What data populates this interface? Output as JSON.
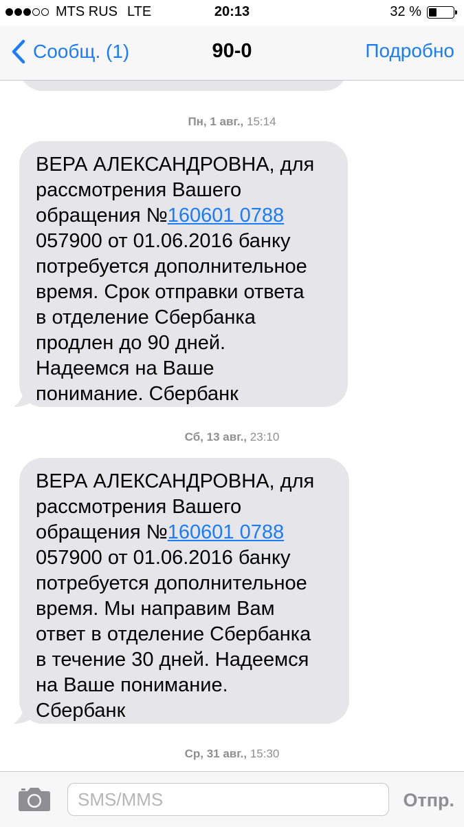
{
  "status_bar": {
    "signal_filled": 3,
    "signal_empty": 2,
    "carrier": "MTS RUS",
    "network": "LTE",
    "time": "20:13",
    "battery_text": "32 %",
    "battery_level": 0.32
  },
  "nav": {
    "back_label": "Сообщ. (1)",
    "title": "90-0",
    "details_label": "Подробно"
  },
  "messages": [
    {
      "day": "Пн, 1 авг.,",
      "time": "15:14",
      "lines": [
        [
          "ВЕРА АЛЕКСАНДРОВНА, для"
        ],
        [
          "рассмотрения Вашего"
        ],
        [
          "обращения №",
          "160601 0788"
        ],
        [
          "057900 от 01.06.2016 банку"
        ],
        [
          "потребуется дополнительное"
        ],
        [
          "время. Срок отправки ответа"
        ],
        [
          "в отделение Сбербанка"
        ],
        [
          "продлен до 90 дней."
        ],
        [
          "Надеемся на Ваше"
        ],
        [
          "понимание. Сбербанк"
        ]
      ]
    },
    {
      "day": "Сб, 13 авг.,",
      "time": "23:10",
      "lines": [
        [
          "ВЕРА АЛЕКСАНДРОВНА, для"
        ],
        [
          "рассмотрения Вашего"
        ],
        [
          "обращения №",
          "160601 0788"
        ],
        [
          "057900 от 01.06.2016 банку"
        ],
        [
          "потребуется дополнительное"
        ],
        [
          "время. Мы направим Вам"
        ],
        [
          "ответ в отделение Сбербанка"
        ],
        [
          "в течение 30 дней. Надеемся"
        ],
        [
          "на Ваше понимание."
        ],
        [
          "Сбербанк"
        ]
      ]
    },
    {
      "day": "Ср, 31 авг.,",
      "time": "15:30",
      "lines": []
    }
  ],
  "input": {
    "placeholder": "SMS/MMS",
    "send_label": "Отпр."
  },
  "colors": {
    "accent": "#1a7cf6",
    "bubble_incoming": "#e5e5ea",
    "timestamp": "#8e8e93"
  },
  "icons": {
    "back": "chevron-left-icon",
    "camera": "camera-icon",
    "battery": "battery-icon",
    "signal": "signal-dots-icon"
  }
}
